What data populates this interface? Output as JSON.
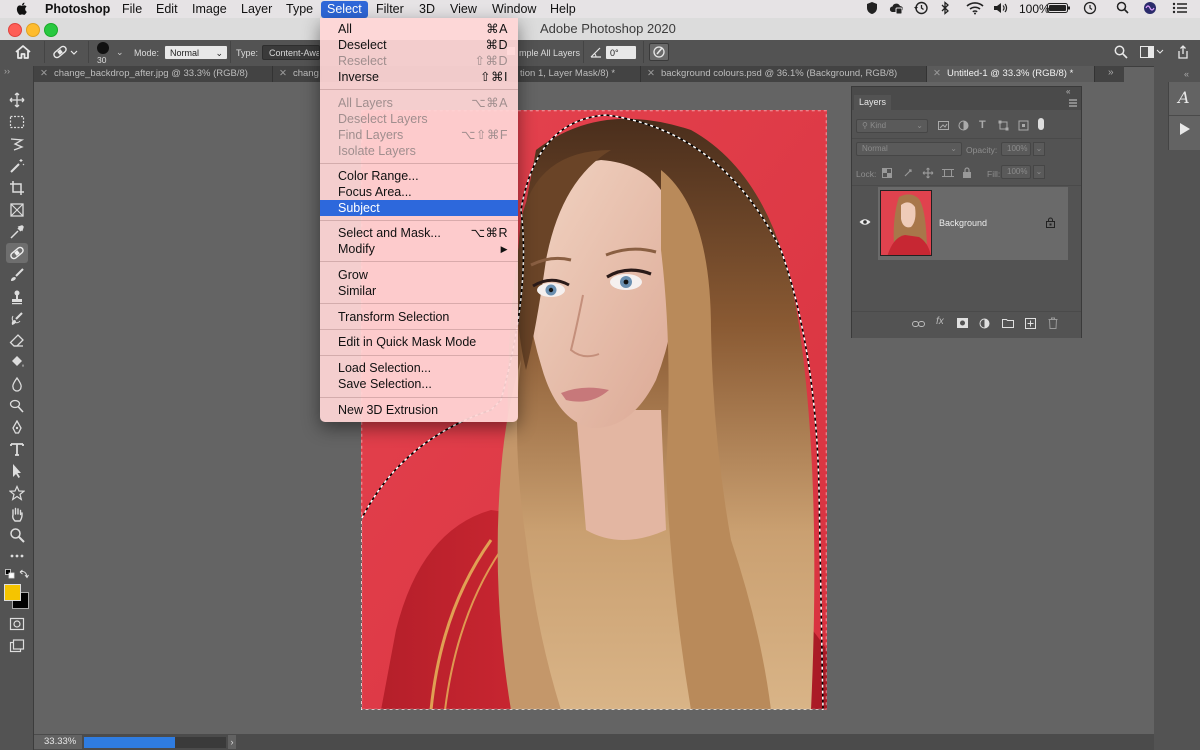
{
  "menubar": {
    "app_name": "Photoshop",
    "items": [
      "File",
      "Edit",
      "Image",
      "Layer",
      "Type",
      "Select",
      "Filter",
      "3D",
      "View",
      "Window",
      "Help"
    ],
    "active_item": "Select",
    "battery_percent": "100%"
  },
  "window": {
    "title": "Adobe Photoshop 2020"
  },
  "options_bar": {
    "brush_size": "30",
    "mode_label": "Mode:",
    "mode_value": "Normal",
    "type_label": "Type:",
    "type_value": "Content-Awa",
    "sample_label": "mple All Layers",
    "angle_value": "0°"
  },
  "tabs": [
    {
      "label": "change_backdrop_after.jpg @ 33.3% (RGB/8)",
      "active": false
    },
    {
      "label": "chang",
      "active": false
    },
    {
      "label": "tion 1, Layer Mask/8) *",
      "active": false
    },
    {
      "label": "background colours.psd @ 36.1% (Background, RGB/8)",
      "active": false
    },
    {
      "label": "Untitled-1 @ 33.3% (RGB/8) *",
      "active": true
    }
  ],
  "select_menu": {
    "items": [
      {
        "label": "All",
        "shortcut": "⌘A",
        "enabled": true
      },
      {
        "label": "Deselect",
        "shortcut": "⌘D",
        "enabled": true
      },
      {
        "label": "Reselect",
        "shortcut": "⇧⌘D",
        "enabled": false
      },
      {
        "label": "Inverse",
        "shortcut": "⇧⌘I",
        "enabled": true
      },
      {
        "label": "All Layers",
        "shortcut": "⌥⌘A",
        "enabled": false
      },
      {
        "label": "Deselect Layers",
        "shortcut": "",
        "enabled": false
      },
      {
        "label": "Find Layers",
        "shortcut": "⌥⇧⌘F",
        "enabled": false
      },
      {
        "label": "Isolate Layers",
        "shortcut": "",
        "enabled": false
      },
      {
        "label": "Color Range...",
        "shortcut": "",
        "enabled": true
      },
      {
        "label": "Focus Area...",
        "shortcut": "",
        "enabled": true
      },
      {
        "label": "Subject",
        "shortcut": "",
        "enabled": true,
        "highlighted": true
      },
      {
        "label": "Select and Mask...",
        "shortcut": "⌥⌘R",
        "enabled": true
      },
      {
        "label": "Modify",
        "shortcut": "▶",
        "enabled": true
      },
      {
        "label": "Grow",
        "shortcut": "",
        "enabled": true
      },
      {
        "label": "Similar",
        "shortcut": "",
        "enabled": true
      },
      {
        "label": "Transform Selection",
        "shortcut": "",
        "enabled": true
      },
      {
        "label": "Edit in Quick Mask Mode",
        "shortcut": "",
        "enabled": true
      },
      {
        "label": "Load Selection...",
        "shortcut": "",
        "enabled": true
      },
      {
        "label": "Save Selection...",
        "shortcut": "",
        "enabled": true
      },
      {
        "label": "New 3D Extrusion",
        "shortcut": "",
        "enabled": true
      }
    ]
  },
  "layers_panel": {
    "tab_label": "Layers",
    "filter_kind": "Kind",
    "blend_mode": "Normal",
    "opacity_label": "Opacity:",
    "opacity_value": "100%",
    "lock_label": "Lock:",
    "fill_label": "Fill:",
    "fill_value": "100%",
    "layer_name": "Background"
  },
  "status_bar": {
    "zoom": "33.33%",
    "progress": 0.64
  },
  "colors": {
    "accent": "#2d68dc",
    "foreground_swatch": "#f5c400",
    "background_swatch": "#000000",
    "photo_backdrop": "#e04550"
  }
}
